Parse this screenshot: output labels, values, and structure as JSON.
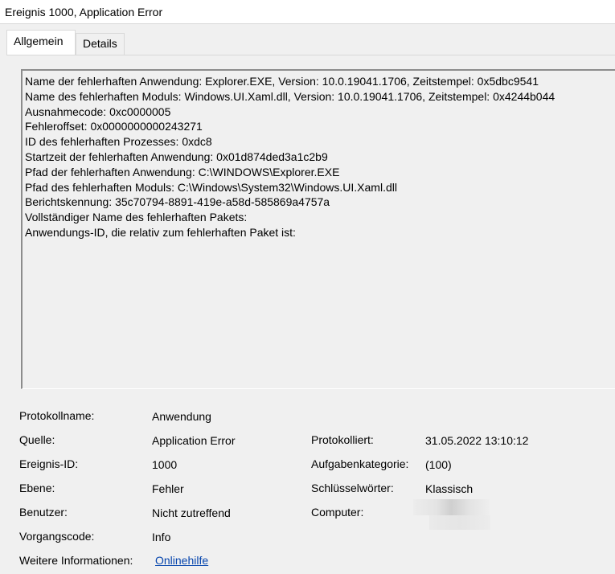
{
  "window": {
    "title": "Ereignis 1000, Application Error"
  },
  "tabs": [
    {
      "label": "Allgemein",
      "active": true
    },
    {
      "label": "Details",
      "active": false
    }
  ],
  "description_lines": [
    "Name der fehlerhaften Anwendung: Explorer.EXE, Version: 10.0.19041.1706, Zeitstempel: 0x5dbc9541",
    "Name des fehlerhaften Moduls: Windows.UI.Xaml.dll, Version: 10.0.19041.1706, Zeitstempel: 0x4244b044",
    "Ausnahmecode: 0xc0000005",
    "Fehleroffset: 0x0000000000243271",
    "ID des fehlerhaften Prozesses: 0xdc8",
    "Startzeit der fehlerhaften Anwendung: 0x01d874ded3a1c2b9",
    "Pfad der fehlerhaften Anwendung: C:\\WINDOWS\\Explorer.EXE",
    "Pfad des fehlerhaften Moduls: C:\\Windows\\System32\\Windows.UI.Xaml.dll",
    "Berichtskennung: 35c70794-8891-419e-a58d-585869a4757a",
    "Vollständiger Name des fehlerhaften Pakets:",
    "Anwendungs-ID, die relativ zum fehlerhaften Paket ist:"
  ],
  "fields": {
    "log_name": {
      "label": "Protokollname:",
      "value": "Anwendung"
    },
    "source": {
      "label": "Quelle:",
      "value": "Application Error"
    },
    "logged": {
      "label": "Protokolliert:",
      "value": "31.05.2022 13:10:12"
    },
    "event_id": {
      "label": "Ereignis-ID:",
      "value": "1000"
    },
    "task_category": {
      "label": "Aufgabenkategorie:",
      "value": "(100)"
    },
    "level": {
      "label": "Ebene:",
      "value": "Fehler"
    },
    "keywords": {
      "label": "Schlüsselwörter:",
      "value": "Klassisch"
    },
    "user": {
      "label": "Benutzer:",
      "value": "Nicht zutreffend"
    },
    "computer": {
      "label": "Computer:",
      "value": ""
    },
    "opcode": {
      "label": "Vorgangscode:",
      "value": "Info"
    },
    "more_info": {
      "label": "Weitere Informationen:",
      "link": "Onlinehilfe"
    }
  },
  "colors": {
    "link": "#0645ad",
    "background": "#f0f0f0"
  }
}
